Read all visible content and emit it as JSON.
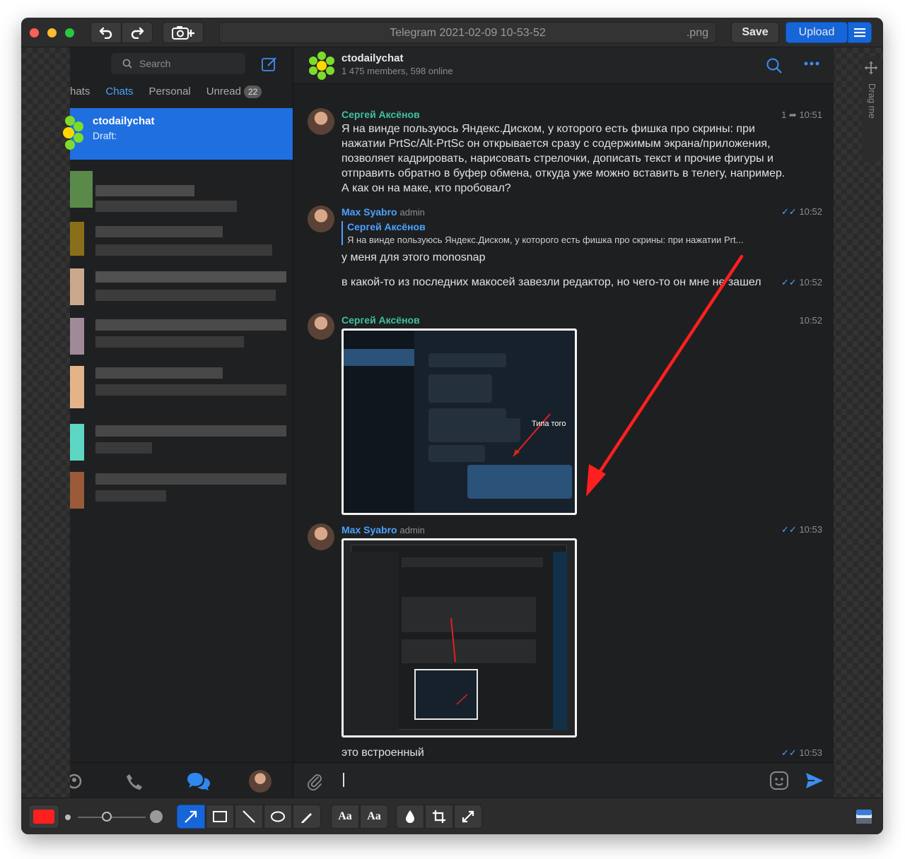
{
  "window": {
    "filename": "Telegram 2021-02-09 10-53-52",
    "extension": ".png",
    "save_label": "Save",
    "upload_label": "Upload",
    "drag_label": "Drag me"
  },
  "sidebar": {
    "search_placeholder": "Search",
    "folders": [
      {
        "label": "hats"
      },
      {
        "label": "Chats"
      },
      {
        "label": "Personal"
      },
      {
        "label": "Unread",
        "badge": "22"
      }
    ],
    "active_chat": {
      "title": "ctodailychat",
      "subtitle": "Draft:"
    }
  },
  "chat": {
    "name": "ctodailychat",
    "members": "1 475 members, 598 online",
    "messages": [
      {
        "author": "Сергей Аксёнов",
        "reply_count": "1",
        "time": "10:51",
        "text": "Я на винде пользуюсь Яндекс.Диском, у которого есть фишка про скрины: при нажатии PrtSc/Alt-PrtSc он открывается сразу с содержимым экрана/приложения, позволяет кадрировать, нарисовать стрелочки, дописать текст и прочие фигуры и отправить обратно в буфер обмена, откуда уже можно вставить в телегу, например. А как он на маке, кто пробовал?"
      },
      {
        "author": "Max Syabro",
        "role": "admin",
        "time": "10:52",
        "reply_author": "Сергей Аксёнов",
        "reply_text": "Я на винде пользуюсь Яндекс.Диском, у которого есть фишка про скрины: при нажатии Prt...",
        "text": "у меня для этого monosnap"
      },
      {
        "time": "10:52",
        "text": "в какой-то из последних макосей завезли редактор, но чего-то он мне не зашел"
      },
      {
        "author": "Сергей Аксёнов",
        "time": "10:52",
        "image_caption": "Типа того"
      },
      {
        "author": "Max Syabro",
        "role": "admin",
        "time": "10:53"
      },
      {
        "time": "10:53",
        "text": "это встроенный"
      }
    ]
  },
  "colors": {
    "accent": "#1f6fe0",
    "link": "#4aa3ff",
    "author_green": "#3fc1a1",
    "annotation_red": "#ff1f1f"
  }
}
